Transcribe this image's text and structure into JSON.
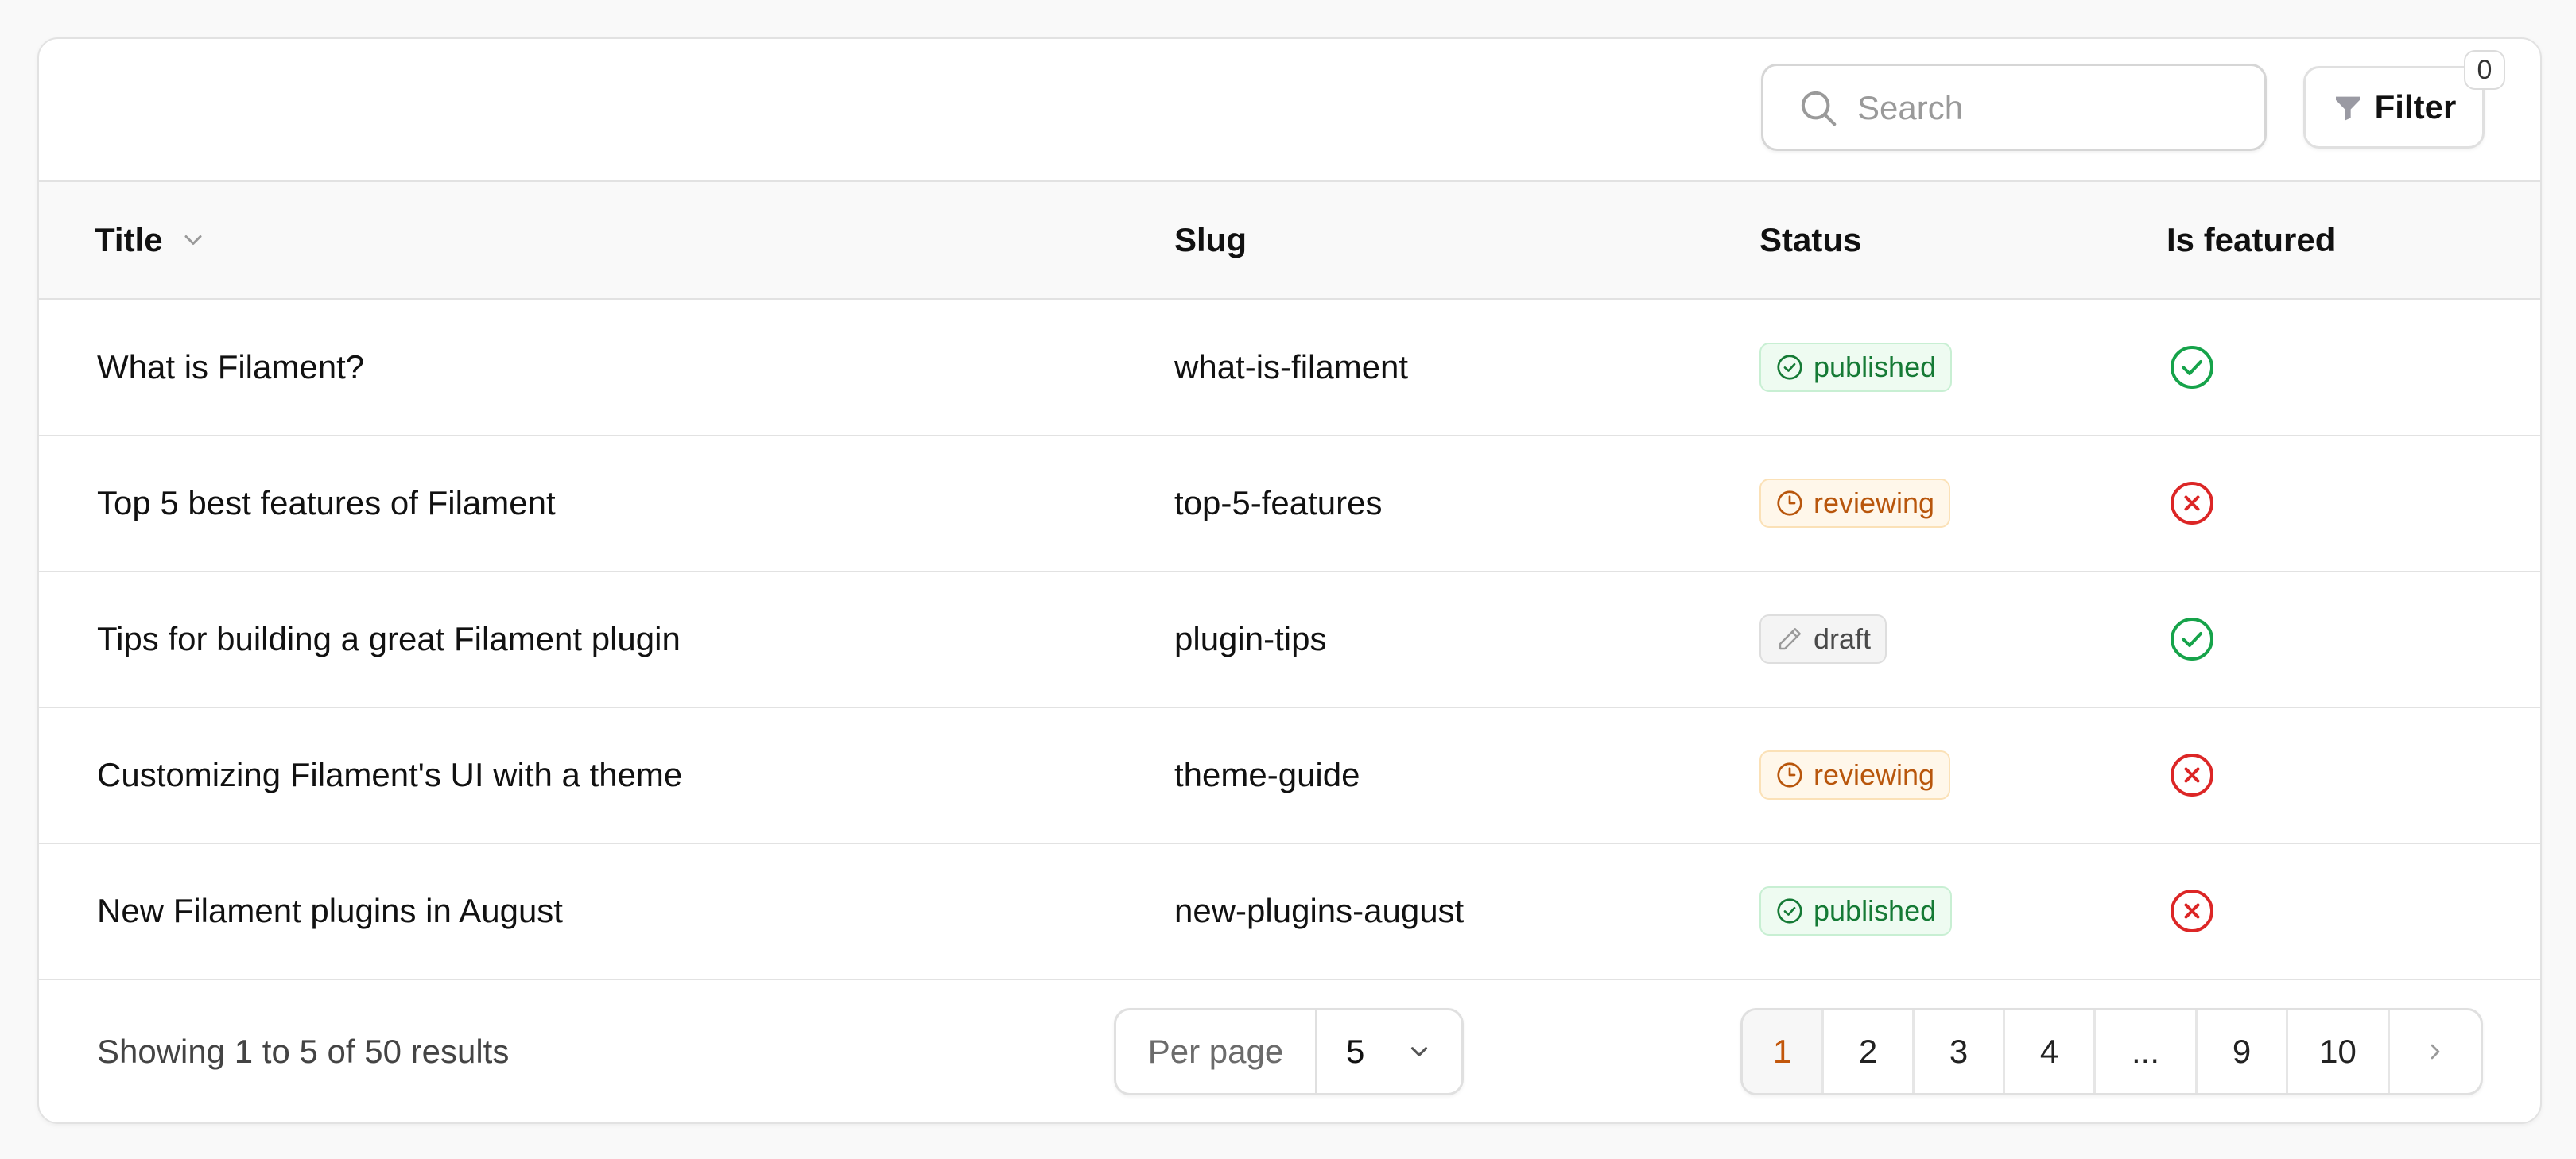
{
  "toolbar": {
    "search_placeholder": "Search",
    "search_value": "",
    "filter_label": "Filter",
    "filter_count": "0"
  },
  "table": {
    "columns": {
      "title": "Title",
      "slug": "Slug",
      "status": "Status",
      "featured": "Is featured"
    },
    "sorted_column": "title",
    "rows": [
      {
        "title": "What is Filament?",
        "slug": "what-is-filament",
        "status": "published",
        "featured": true
      },
      {
        "title": "Top 5 best features of Filament",
        "slug": "top-5-features",
        "status": "reviewing",
        "featured": false
      },
      {
        "title": "Tips for building a great Filament plugin",
        "slug": "plugin-tips",
        "status": "draft",
        "featured": true
      },
      {
        "title": "Customizing Filament's UI with a theme",
        "slug": "theme-guide",
        "status": "reviewing",
        "featured": false
      },
      {
        "title": "New Filament plugins in August",
        "slug": "new-plugins-august",
        "status": "published",
        "featured": false
      }
    ]
  },
  "footer": {
    "results_text": "Showing 1 to 5 of 50 results",
    "per_page_label": "Per page",
    "per_page_value": "5",
    "pages": [
      "1",
      "2",
      "3",
      "4",
      "...",
      "9",
      "10"
    ],
    "current_page": "1"
  },
  "icons": {
    "search": "search-icon",
    "filter": "funnel-icon",
    "sort": "chevron-down-icon",
    "published": "check-circle-icon",
    "reviewing": "clock-icon",
    "draft": "pencil-icon",
    "featured_true": "check-circle-icon",
    "featured_false": "x-circle-icon",
    "next": "chevron-right-icon"
  },
  "colors": {
    "published": "#157a35",
    "reviewing": "#b8560c",
    "draft": "#4a4a4a",
    "success": "#16a34a",
    "danger": "#dc2626",
    "active_page": "#c2570c"
  }
}
